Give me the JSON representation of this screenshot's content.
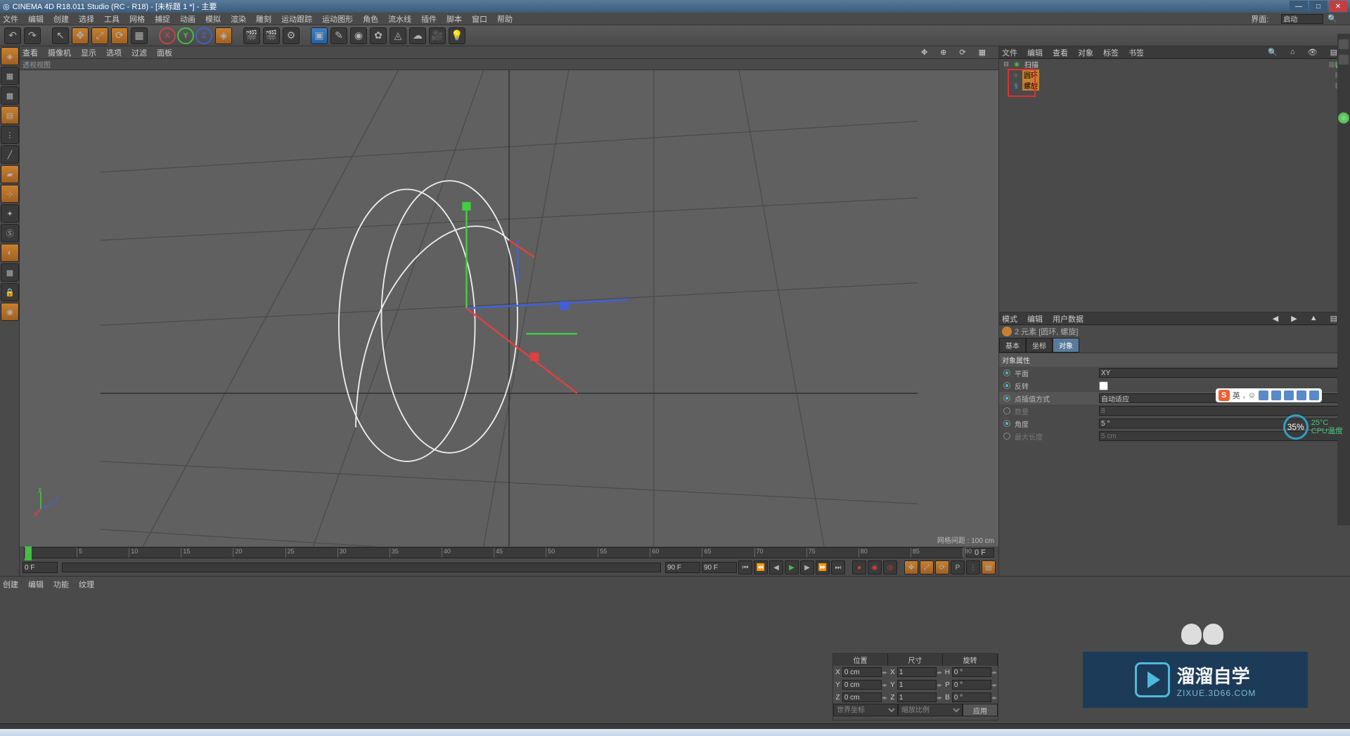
{
  "title": "CINEMA 4D R18.011 Studio (RC - R18) - [未标题 1 *] - 主要",
  "menu": [
    "文件",
    "编辑",
    "创建",
    "选择",
    "工具",
    "网格",
    "捕捉",
    "动画",
    "模拟",
    "渲染",
    "雕刻",
    "运动跟踪",
    "运动图形",
    "角色",
    "流水线",
    "插件",
    "脚本",
    "窗口",
    "帮助"
  ],
  "menu_right_label": "界面:",
  "menu_right_value": "启动",
  "viewport_menu": [
    "查看",
    "摄像机",
    "显示",
    "选项",
    "过滤",
    "面板"
  ],
  "viewport_title": "透视视图",
  "viewport_status": "网格间距 : 100 cm",
  "timeline": {
    "start": 0,
    "end": 90,
    "step": 5,
    "current": "0 F",
    "end_label": "0 F",
    "field_start": "0 F",
    "field_mid": "90 F",
    "field_end": "90 F"
  },
  "material_menu": [
    "创建",
    "编辑",
    "功能",
    "纹理"
  ],
  "obj_panel_menu": [
    "文件",
    "编辑",
    "查看",
    "对象",
    "标签",
    "书签"
  ],
  "tree": [
    {
      "name": "扫描",
      "level": 0,
      "sel": false,
      "icon": "sweep"
    },
    {
      "name": "圆环",
      "level": 1,
      "sel": true,
      "icon": "circle"
    },
    {
      "name": "螺旋",
      "level": 1,
      "sel": true,
      "icon": "helix"
    }
  ],
  "attr_menu": [
    "模式",
    "编辑",
    "用户数据"
  ],
  "elements_label": "2 元素 [圆环, 螺旋]",
  "attr_tabs": [
    "基本",
    "坐标",
    "对象"
  ],
  "attr_section1": "对象属性",
  "attr_rows1": [
    {
      "label": "平面",
      "value": "XY",
      "type": "select",
      "radio": true
    },
    {
      "label": "反转",
      "value": "",
      "type": "check",
      "radio": true
    }
  ],
  "attr_section2_label": "点插值方式",
  "attr_section2_value": "自动适应",
  "attr_rows2": [
    {
      "label": "数量",
      "value": "8",
      "disabled": true
    },
    {
      "label": "角度",
      "value": "5 °",
      "disabled": false,
      "radio": true
    },
    {
      "label": "最大长度",
      "value": "5 cm",
      "disabled": true
    }
  ],
  "coord": {
    "headers": [
      "位置",
      "尺寸",
      "旋转"
    ],
    "rows": [
      {
        "a": "X",
        "v1": "0 cm",
        "v2": "X",
        "v3": "1",
        "v4": "H",
        "v5": "0 °"
      },
      {
        "a": "Y",
        "v1": "0 cm",
        "v2": "Y",
        "v3": "1",
        "v4": "P",
        "v5": "0 °"
      },
      {
        "a": "Z",
        "v1": "0 cm",
        "v2": "Z",
        "v3": "1",
        "v4": "B",
        "v5": "0 °"
      }
    ],
    "footer": [
      "世界坐标",
      "缩放比例",
      "应用"
    ]
  },
  "ime": {
    "lang": "英",
    "glyphs": [
      ",",
      "☺",
      "✎",
      "▦",
      "♪",
      "⧉",
      "≡"
    ]
  },
  "temp": {
    "pct": "35%",
    "deg": "25°C",
    "label": "CPU温度"
  },
  "watermark": {
    "cn": "溜溜自学",
    "url": "ZIXUE.3D66.COM"
  }
}
